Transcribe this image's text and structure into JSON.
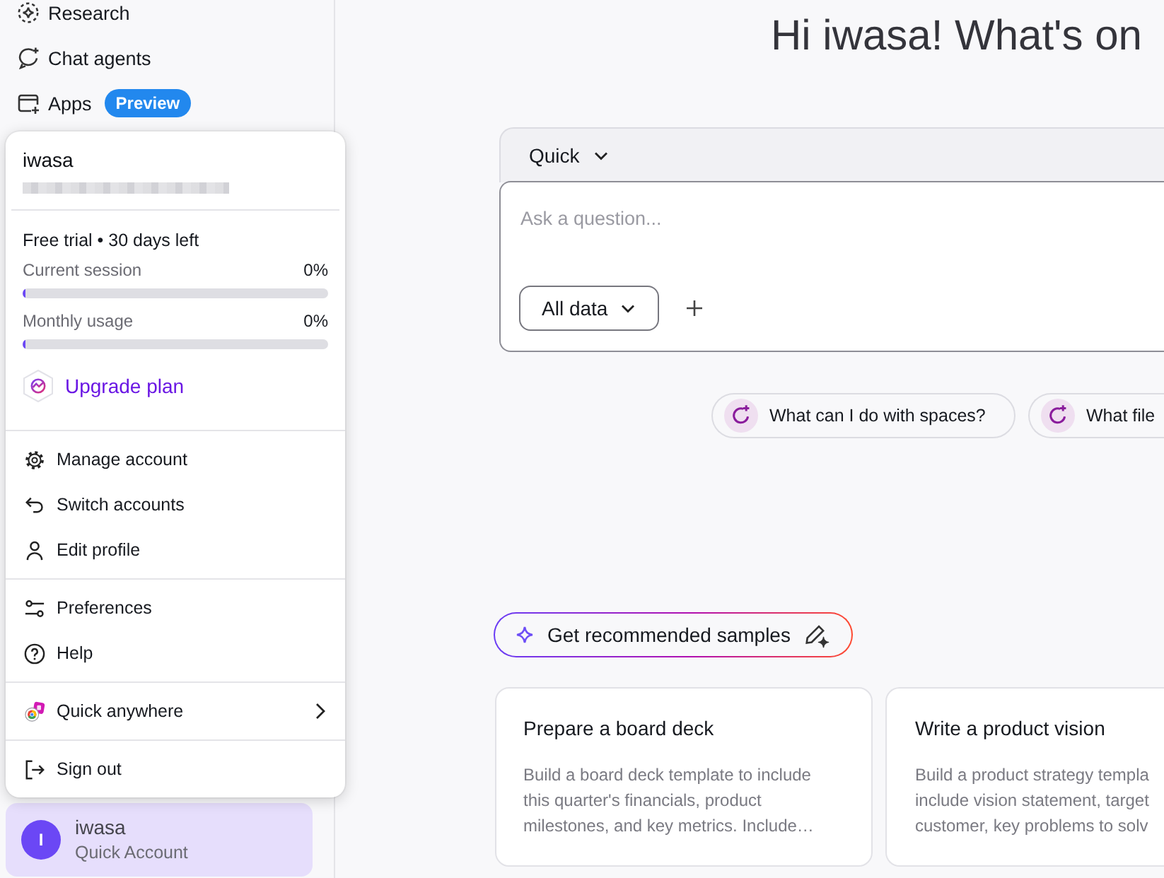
{
  "sidebar": {
    "nav_items": [
      {
        "label": "Research"
      },
      {
        "label": "Chat agents"
      },
      {
        "label": "Apps",
        "badge": "Preview"
      }
    ],
    "account_card": {
      "avatar_initial": "I",
      "name": "iwasa",
      "account_type": "Quick Account"
    }
  },
  "account_menu": {
    "user_name": "iwasa",
    "plan_status": "Free trial • 30 days left",
    "meters": [
      {
        "label": "Current session",
        "reading": "0%",
        "level": 0
      },
      {
        "label": "Monthly usage",
        "reading": "0%",
        "level": 0
      }
    ],
    "upgrade_link": "Upgrade plan",
    "groups": [
      {
        "items": [
          {
            "label": "Manage account",
            "has_submenu": false
          },
          {
            "label": "Switch accounts",
            "has_submenu": false
          },
          {
            "label": "Edit profile",
            "has_submenu": false
          }
        ]
      },
      {
        "items": [
          {
            "label": "Preferences",
            "has_submenu": false
          },
          {
            "label": "Help",
            "has_submenu": false
          }
        ]
      },
      {
        "items": [
          {
            "label": "Quick anywhere",
            "has_submenu": true
          }
        ]
      },
      {
        "items": [
          {
            "label": "Sign out",
            "has_submenu": false
          }
        ]
      }
    ]
  },
  "main": {
    "greeting": "Hi iwasa! What's on",
    "composer": {
      "mode": "Quick",
      "placeholder": "Ask a question...",
      "scope": "All data"
    },
    "suggestions": [
      {
        "label": "What can I do with spaces?"
      },
      {
        "label": "What file"
      }
    ],
    "samples_button": "Get recommended samples",
    "sample_cards": [
      {
        "title": "Prepare a board deck",
        "description_lines": [
          "Build a board deck template to include",
          "this quarter's financials, product",
          "milestones, and key metrics. Include…"
        ]
      },
      {
        "title": "Write a product vision",
        "description_lines": [
          "Build a product strategy templa",
          "include vision statement, target",
          "customer, key problems to solv"
        ]
      }
    ]
  }
}
